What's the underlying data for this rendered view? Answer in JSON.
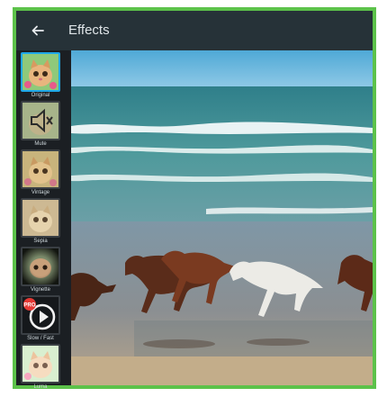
{
  "app": {
    "title": "Effects"
  },
  "effects": [
    {
      "label": "Original",
      "icon": "kitten-thumbnail",
      "selected": true
    },
    {
      "label": "Mute",
      "icon": "speaker-mute-icon",
      "selected": false
    },
    {
      "label": "Vintage",
      "icon": "kitten-thumbnail-vintage",
      "selected": false
    },
    {
      "label": "Sepia",
      "icon": "kitten-thumbnail-sepia",
      "selected": false
    },
    {
      "label": "Vignette",
      "icon": "kitten-thumbnail-vignette",
      "selected": false
    },
    {
      "label": "Slow / Fast",
      "icon": "speed-play-icon",
      "badge": "PRO",
      "selected": false
    },
    {
      "label": "Luma",
      "icon": "kitten-thumbnail-luma",
      "selected": false
    }
  ],
  "colors": {
    "accent": "#1ea7e8",
    "appbar": "#263238",
    "frame_border": "#5cc24a",
    "pro_badge": "#e53935"
  }
}
